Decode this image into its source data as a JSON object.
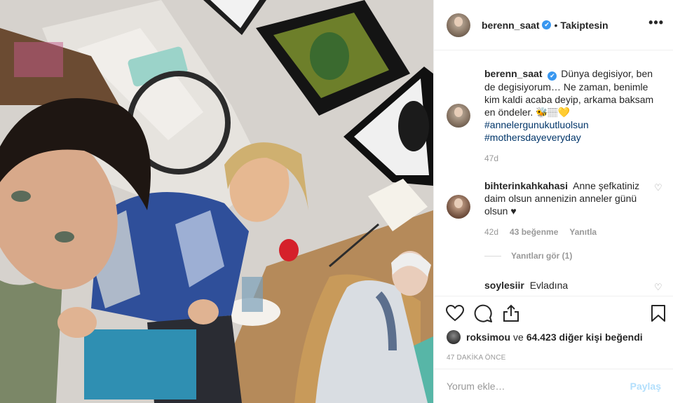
{
  "post": {
    "author": "berenn_saat",
    "follow_status": "Takiptesin",
    "separator": "•",
    "verified_mark": "✔",
    "more_icon": "more-horizontal-icon"
  },
  "caption": {
    "username": "berenn_saat",
    "text": "Dünya degisiyor, ben de degisiyorum… Ne zaman, benimle kim kaldi acaba deyip, arkama baksam en öndeler. 🐝🏽💛",
    "hashtags": [
      "#annelergunukutluolsun",
      "#mothersdayeveryday"
    ],
    "age": "47d"
  },
  "comments": [
    {
      "username": "bihterinkahkahasi",
      "text": "Anne şefkatiniz daim olsun annenizin anneler günü olsun ♥",
      "age": "42d",
      "likes": "43 beğenme",
      "reply": "Yanıtla",
      "view_replies": "Yanıtları gör (1)"
    },
    {
      "username": "soylesiir",
      "text": "Evladına"
    }
  ],
  "likes": {
    "liker": "roksimou",
    "connector": "ve",
    "count_text": "64.423 diğer kişi",
    "suffix": "beğendi"
  },
  "timestamp": "47 DAKİKA ÖNCE",
  "comment_box": {
    "placeholder": "Yorum ekle…",
    "post_label": "Paylaş"
  },
  "colors": {
    "link_blue": "#003569",
    "verified_blue": "#3897f0",
    "muted_gray": "#999999",
    "post_button_disabled": "#b2dffc"
  }
}
